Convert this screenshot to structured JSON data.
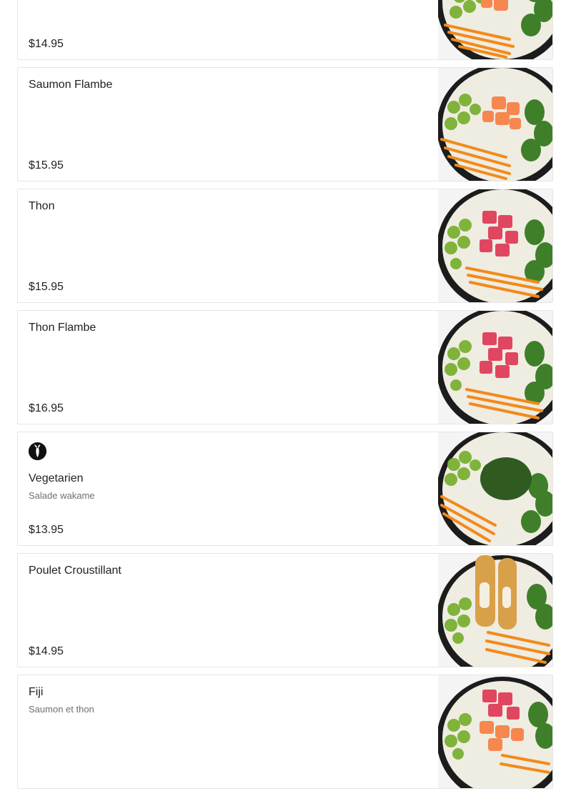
{
  "menu": {
    "items": [
      {
        "name": "",
        "description": "",
        "price": "$14.95",
        "vegetarian": false,
        "image": "salmon-bowl"
      },
      {
        "name": "Saumon Flambe",
        "description": "",
        "price": "$15.95",
        "vegetarian": false,
        "image": "salmon-bowl"
      },
      {
        "name": "Thon",
        "description": "",
        "price": "$15.95",
        "vegetarian": false,
        "image": "tuna-bowl"
      },
      {
        "name": "Thon Flambe",
        "description": "",
        "price": "$16.95",
        "vegetarian": false,
        "image": "tuna-bowl"
      },
      {
        "name": "Vegetarien",
        "description": "Salade wakame",
        "price": "$13.95",
        "vegetarian": true,
        "image": "wakame-bowl"
      },
      {
        "name": "Poulet Croustillant",
        "description": "",
        "price": "$14.95",
        "vegetarian": false,
        "image": "chicken-bowl"
      },
      {
        "name": "Fiji",
        "description": "Saumon et thon",
        "price": "",
        "vegetarian": false,
        "image": "fiji-bowl"
      }
    ]
  },
  "colors": {
    "bowl": "#1c1c1c",
    "rice": "#efece2",
    "carrot": "#f28a1a",
    "edamame": "#7fb33a",
    "cucumber": "#3f7f2a",
    "salmon": "#f6874f",
    "tuna": "#e04660",
    "wakame": "#2f5a20",
    "chicken": "#d9a04a"
  }
}
